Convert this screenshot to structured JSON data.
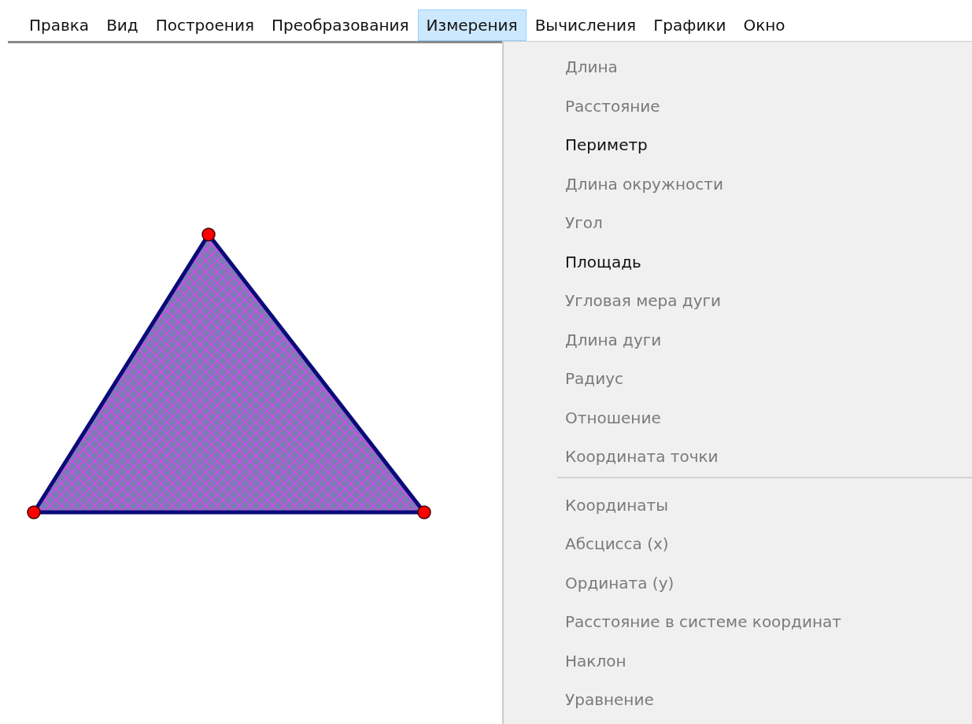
{
  "menu_bar": [
    {
      "label": "Правка",
      "selected": false
    },
    {
      "label": "Вид",
      "selected": false
    },
    {
      "label": "Построения",
      "selected": false
    },
    {
      "label": "Преобразования",
      "selected": false
    },
    {
      "label": "Измерения",
      "selected": true
    },
    {
      "label": "Вычисления",
      "selected": false
    },
    {
      "label": "Графики",
      "selected": false
    },
    {
      "label": "Окно",
      "selected": false
    }
  ],
  "menu": {
    "items": [
      {
        "kind": "item",
        "label": "Длина",
        "disabled": true
      },
      {
        "kind": "item",
        "label": "Расстояние",
        "disabled": true
      },
      {
        "kind": "item",
        "label": "Периметр",
        "disabled": false
      },
      {
        "kind": "item",
        "label": "Длина окружности",
        "disabled": true
      },
      {
        "kind": "item",
        "label": "Угол",
        "disabled": true
      },
      {
        "kind": "item",
        "label": "Площадь",
        "disabled": false
      },
      {
        "kind": "item",
        "label": "Угловая мера дуги",
        "disabled": true
      },
      {
        "kind": "item",
        "label": "Длина дуги",
        "disabled": true
      },
      {
        "kind": "item",
        "label": "Радиус",
        "disabled": true
      },
      {
        "kind": "item",
        "label": "Отношение",
        "disabled": true
      },
      {
        "kind": "item",
        "label": "Координата точки",
        "disabled": true
      },
      {
        "kind": "separator"
      },
      {
        "kind": "item",
        "label": "Координаты",
        "disabled": true
      },
      {
        "kind": "item",
        "label": "Абсцисса (x)",
        "disabled": true
      },
      {
        "kind": "item",
        "label": "Ордината (y)",
        "disabled": true
      },
      {
        "kind": "item",
        "label": "Расстояние в системе координат",
        "disabled": true
      },
      {
        "kind": "item",
        "label": "Наклон",
        "disabled": true
      },
      {
        "kind": "item",
        "label": "Уравнение",
        "disabled": true
      }
    ]
  }
}
